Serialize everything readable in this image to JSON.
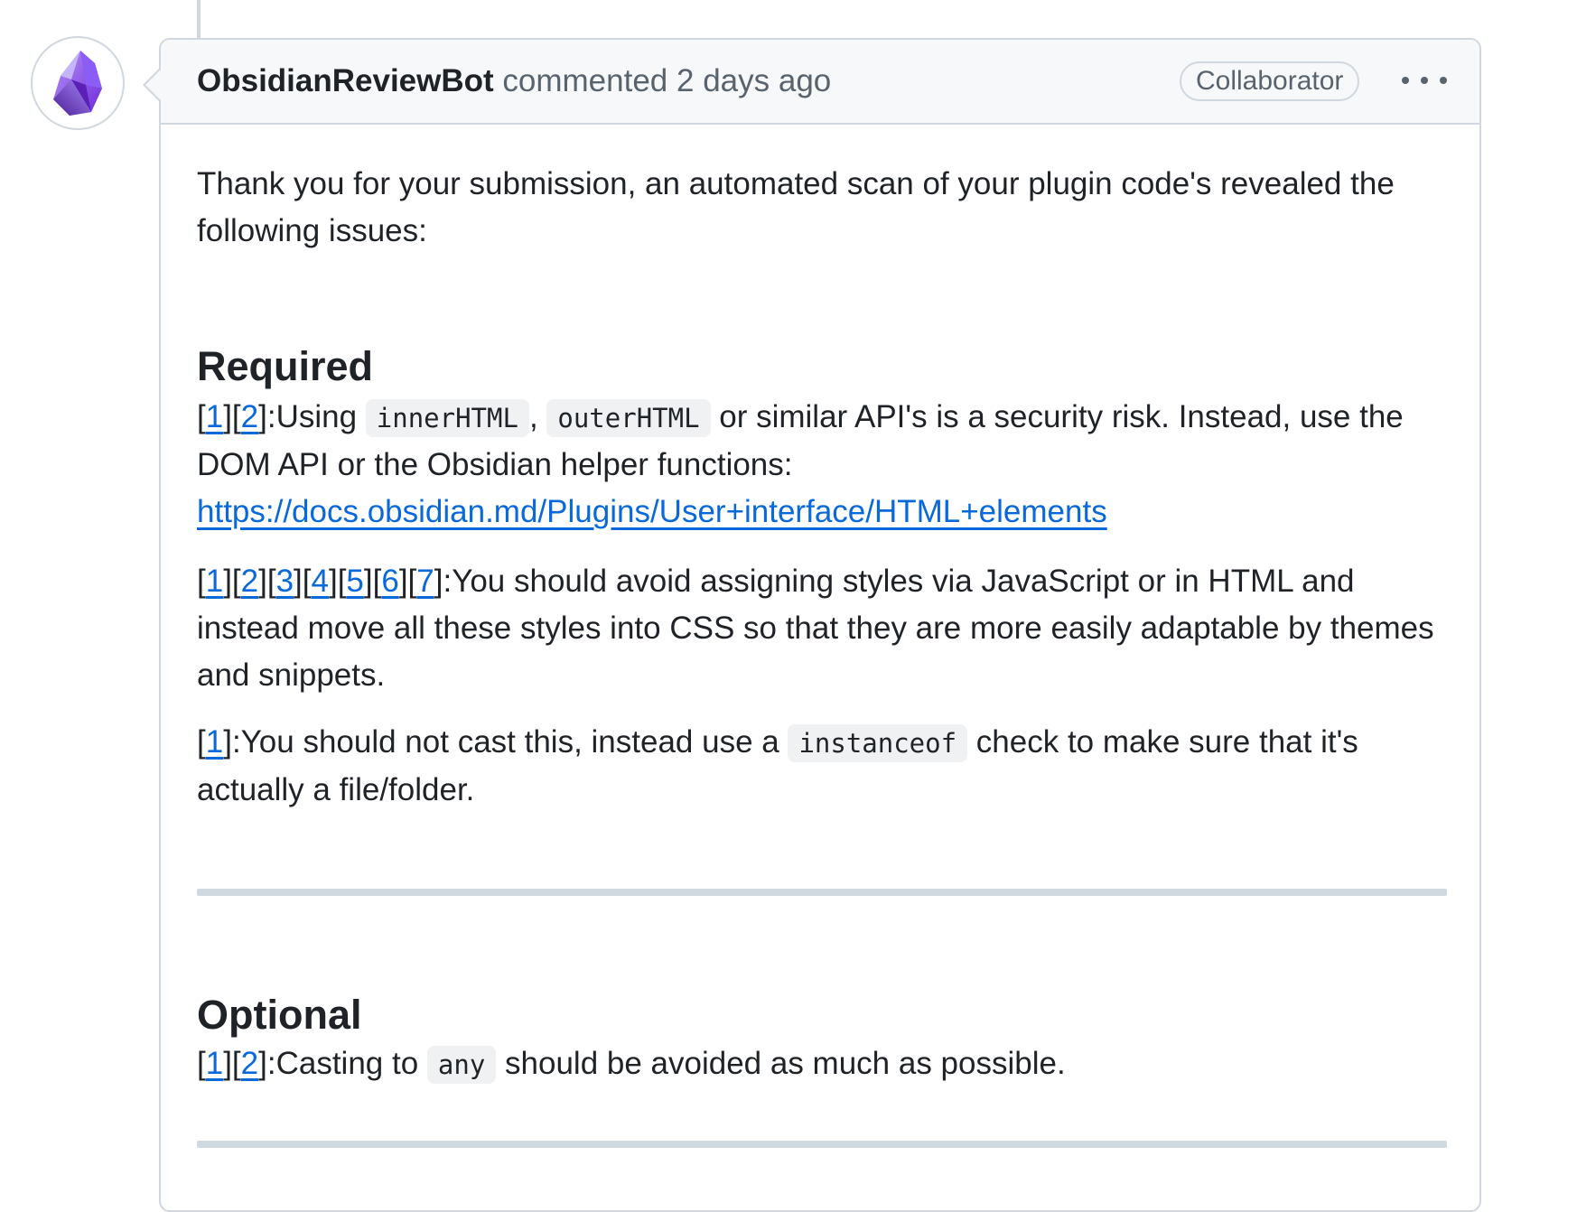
{
  "comment": {
    "author": "ObsidianReviewBot",
    "action": "commented",
    "time": "2 days ago",
    "role_badge": "Collaborator",
    "intro": "Thank you for your submission, an automated scan of your plugin code's revealed the following issues:",
    "required": {
      "heading": "Required",
      "items": [
        {
          "refs": [
            "1",
            "2"
          ],
          "text_before": ":Using ",
          "code1": "innerHTML",
          "separator": ", ",
          "code2": "outerHTML",
          "text_after": " or similar API's is a security risk. Instead, use the DOM API or the Obsidian helper functions: ",
          "link": "https://docs.obsidian.md/Plugins/User+interface/HTML+elements"
        },
        {
          "refs": [
            "1",
            "2",
            "3",
            "4",
            "5",
            "6",
            "7"
          ],
          "text": ":You should avoid assigning styles via JavaScript or in HTML and instead move all these styles into CSS so that they are more easily adaptable by themes and snippets."
        },
        {
          "refs": [
            "1"
          ],
          "text_before": ":You should not cast this, instead use a ",
          "code": "instanceof",
          "text_after": " check to make sure that it's actually a file/folder."
        }
      ]
    },
    "optional": {
      "heading": "Optional",
      "items": [
        {
          "refs": [
            "1",
            "2"
          ],
          "text_before": ":Casting to ",
          "code": "any",
          "text_after": " should be avoided as much as possible."
        }
      ]
    }
  },
  "colors": {
    "link": "#0969da",
    "header_bg": "#f6f8fa",
    "border": "#d0d7de",
    "avatar_purple": "#7c3aed"
  },
  "icons": {
    "avatar": "obsidian-logo-icon",
    "menu": "kebab-menu-icon"
  }
}
